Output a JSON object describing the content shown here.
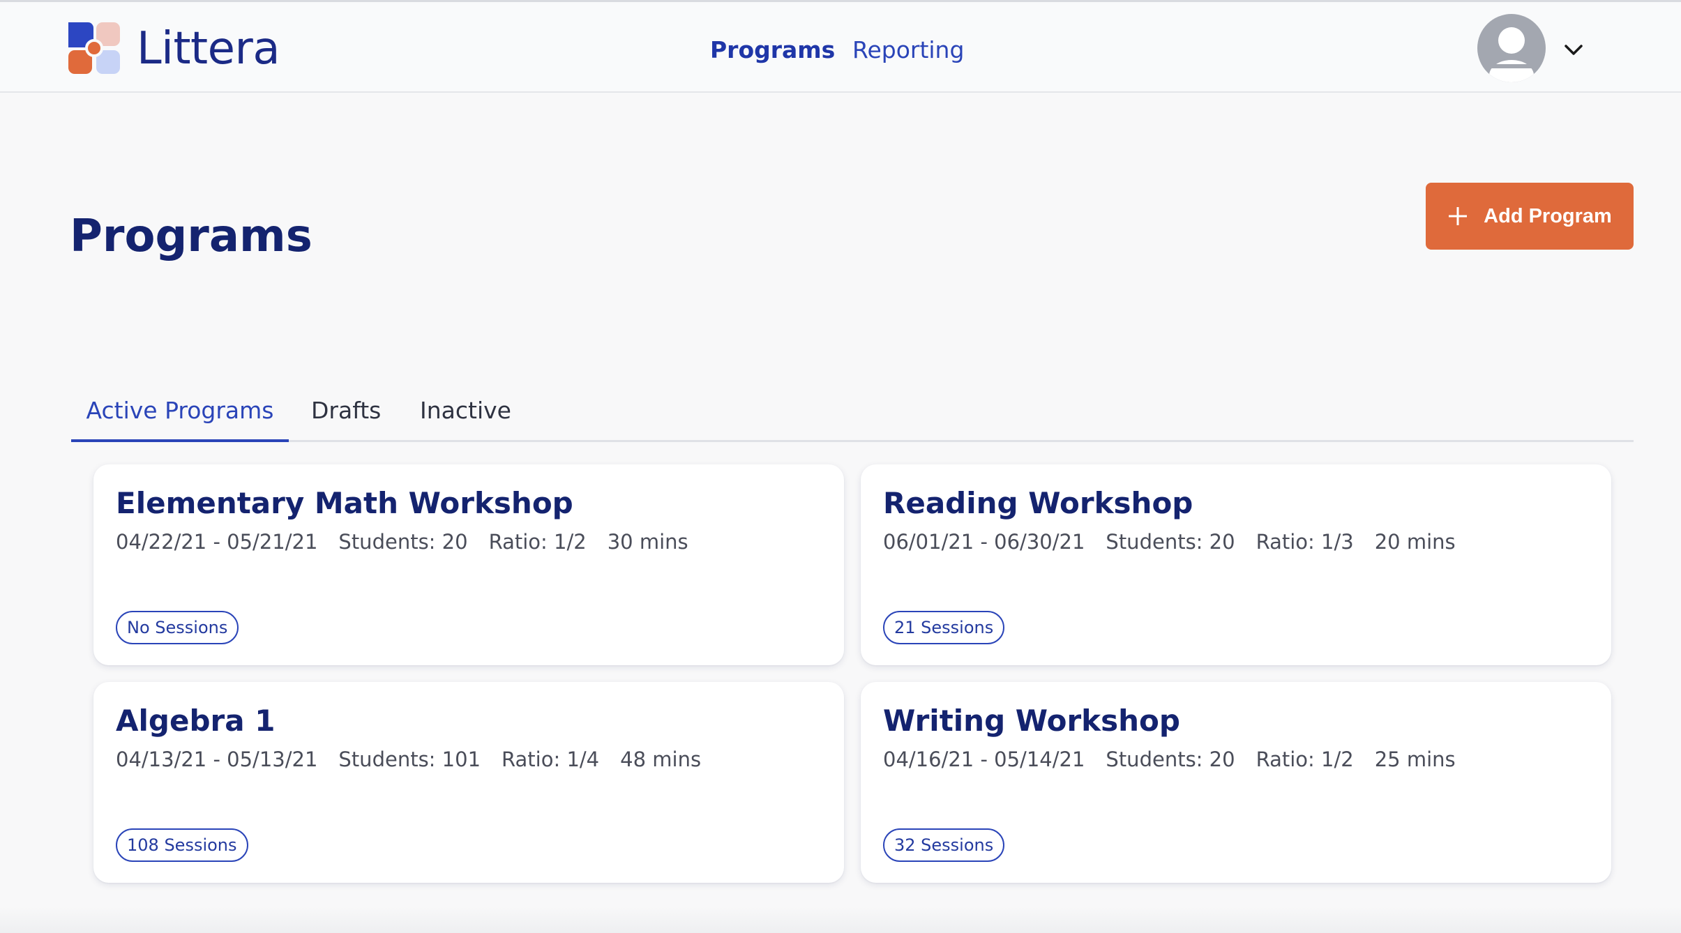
{
  "brand": {
    "name": "Littera",
    "logo_icon": "littera-logo-icon"
  },
  "nav": {
    "items": [
      {
        "label": "Programs",
        "active": true
      },
      {
        "label": "Reporting",
        "active": false
      }
    ],
    "avatar_icon": "user-avatar-icon",
    "menu_icon": "chevron-down-icon"
  },
  "page": {
    "title": "Programs",
    "add_button_label": "Add Program",
    "add_button_icon": "plus-icon"
  },
  "tabs": [
    {
      "label": "Active Programs",
      "active": true
    },
    {
      "label": "Drafts",
      "active": false
    },
    {
      "label": "Inactive",
      "active": false
    }
  ],
  "programs": [
    {
      "title": "Elementary Math Workshop",
      "dates": "04/22/21 - 05/21/21",
      "students": "Students: 20",
      "ratio": "Ratio: 1/2",
      "duration": "30 mins",
      "sessions": "No Sessions"
    },
    {
      "title": "Reading Workshop",
      "dates": "06/01/21 - 06/30/21",
      "students": "Students: 20",
      "ratio": "Ratio: 1/3",
      "duration": "20 mins",
      "sessions": "21 Sessions"
    },
    {
      "title": "Algebra 1",
      "dates": "04/13/21 - 05/13/21",
      "students": "Students: 101",
      "ratio": "Ratio: 1/4",
      "duration": "48 mins",
      "sessions": "108 Sessions"
    },
    {
      "title": "Writing Workshop",
      "dates": "04/16/21 - 05/14/21",
      "students": "Students: 20",
      "ratio": "Ratio: 1/2",
      "duration": "25 mins",
      "sessions": "32 Sessions"
    }
  ],
  "colors": {
    "primary": "#2a44b8",
    "heading": "#14236f",
    "accent": "#df6a3b",
    "background": "#f8f8f9"
  }
}
